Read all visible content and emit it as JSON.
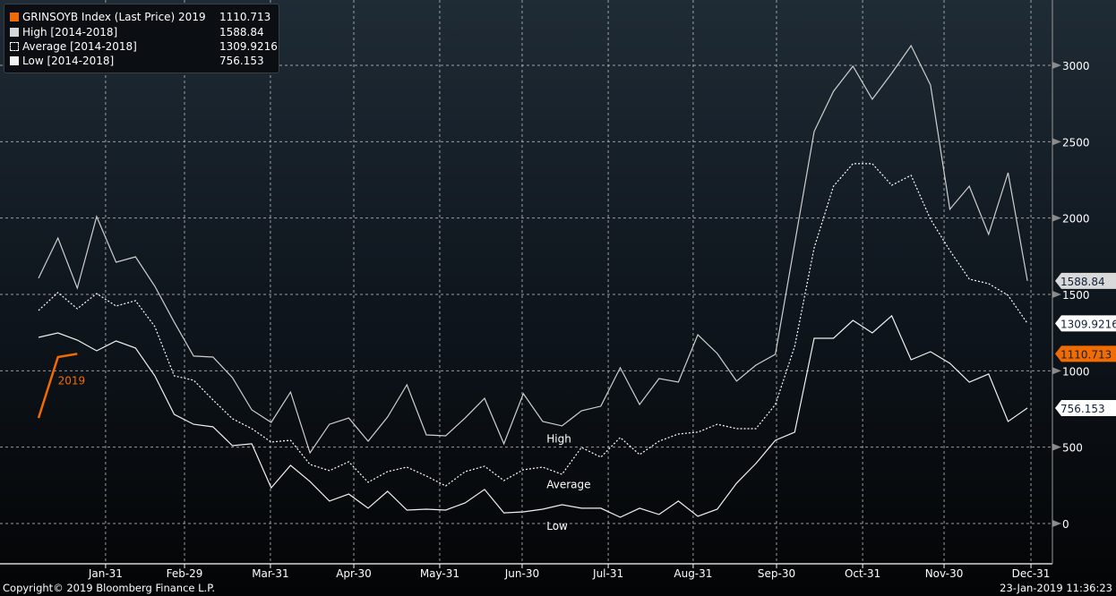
{
  "legend": {
    "items": [
      {
        "name": "GRINSOYB Index (Last Price) 2019",
        "value": "1110.713",
        "color": "#f26b00",
        "style": "solid"
      },
      {
        "name": "High [2014-2018]",
        "value": "1588.84",
        "color": "#d6d6d6",
        "style": "solid"
      },
      {
        "name": "Average [2014-2018]",
        "value": "1309.9216",
        "color": "#ffffff",
        "style": "dotted"
      },
      {
        "name": "Low [2014-2018]",
        "value": "756.153",
        "color": "#f2f2f2",
        "style": "solid"
      }
    ]
  },
  "footer": {
    "copyright": "Copyright© 2019 Bloomberg Finance L.P.",
    "timestamp": "23-Jan-2019 11:36:23"
  },
  "chart_data": {
    "type": "line",
    "title": "GRINSOYB Index seasonality",
    "x_unit": "week index",
    "xlim": [
      0,
      51
    ],
    "ylim": [
      -250,
      3450
    ],
    "grid": true,
    "legend_position": "top-left",
    "x_ticks": [
      {
        "label": "Jan-31",
        "x": 3.46
      },
      {
        "label": "Feb-29",
        "x": 7.53
      },
      {
        "label": "Mar-31",
        "x": 11.96
      },
      {
        "label": "Apr-30",
        "x": 16.26
      },
      {
        "label": "May-31",
        "x": 20.69
      },
      {
        "label": "Jun-30",
        "x": 24.94
      },
      {
        "label": "Jul-31",
        "x": 29.38
      },
      {
        "label": "Aug-31",
        "x": 33.76
      },
      {
        "label": "Sep-30",
        "x": 38.06
      },
      {
        "label": "Oct-31",
        "x": 42.5
      },
      {
        "label": "Nov-30",
        "x": 46.7
      },
      {
        "label": "Dec-31",
        "x": 51.18
      }
    ],
    "y_ticks": [
      0,
      500,
      1000,
      1500,
      2000,
      2500,
      3000
    ],
    "series": [
      {
        "name": "High",
        "label": "High",
        "label_value": 530,
        "label_week": 26.2,
        "color": "#cfcfcf",
        "dash": "",
        "values": [
          1606,
          1869,
          1541,
          2010,
          1711,
          1746,
          1553,
          1319,
          1096,
          1090,
          955,
          744,
          662,
          861,
          463,
          650,
          691,
          539,
          697,
          908,
          580,
          574,
          691,
          820,
          522,
          850,
          668,
          639,
          738,
          768,
          1020,
          779,
          949,
          926,
          1236,
          1113,
          932,
          1037,
          1108,
          1834,
          2567,
          2830,
          2994,
          2778,
          2948,
          3129,
          2871,
          2057,
          2209,
          1893,
          2297,
          1588.84
        ]
      },
      {
        "name": "Average",
        "label": "Average",
        "label_value": 230,
        "label_week": 26.2,
        "color": "#ffffff",
        "dash": "2,2",
        "values": [
          1395,
          1512,
          1406,
          1506,
          1424,
          1459,
          1289,
          967,
          938,
          809,
          686,
          621,
          533,
          545,
          387,
          346,
          404,
          270,
          340,
          369,
          311,
          246,
          340,
          375,
          281,
          352,
          369,
          322,
          498,
          434,
          563,
          451,
          539,
          586,
          598,
          650,
          621,
          621,
          779,
          1160,
          1805,
          2209,
          2356,
          2356,
          2215,
          2280,
          1992,
          1787,
          1600,
          1570,
          1494,
          1309.9216
        ]
      },
      {
        "name": "Low",
        "label": "Low",
        "label_value": -40,
        "label_week": 26.2,
        "color": "#f0f0f0",
        "dash": "",
        "values": [
          1219,
          1248,
          1201,
          1131,
          1195,
          1149,
          967,
          715,
          650,
          633,
          510,
          522,
          234,
          381,
          275,
          147,
          193,
          100,
          211,
          88,
          94,
          88,
          135,
          223,
          70,
          76,
          94,
          123,
          100,
          100,
          41,
          100,
          59,
          147,
          47,
          94,
          264,
          393,
          545,
          598,
          1213,
          1213,
          1330,
          1248,
          1360,
          1072,
          1125,
          1049,
          926,
          979,
          668,
          756.153
        ]
      },
      {
        "name": "2019",
        "label": "2019",
        "label_value": 910,
        "label_week": 1.0,
        "color": "#f26b00",
        "dash": "",
        "values": [
          691,
          1090,
          1110.713
        ]
      }
    ],
    "last_value_tags": [
      {
        "text": "1588.84",
        "value": 1588.84,
        "bg": "#d9d9d9"
      },
      {
        "text": "1309.9216",
        "value": 1309.9216,
        "bg": "#ffffff"
      },
      {
        "text": "1110.713",
        "value": 1110.713,
        "bg": "#f26b00"
      },
      {
        "text": "756.153",
        "value": 756.153,
        "bg": "#ffffff"
      }
    ]
  }
}
